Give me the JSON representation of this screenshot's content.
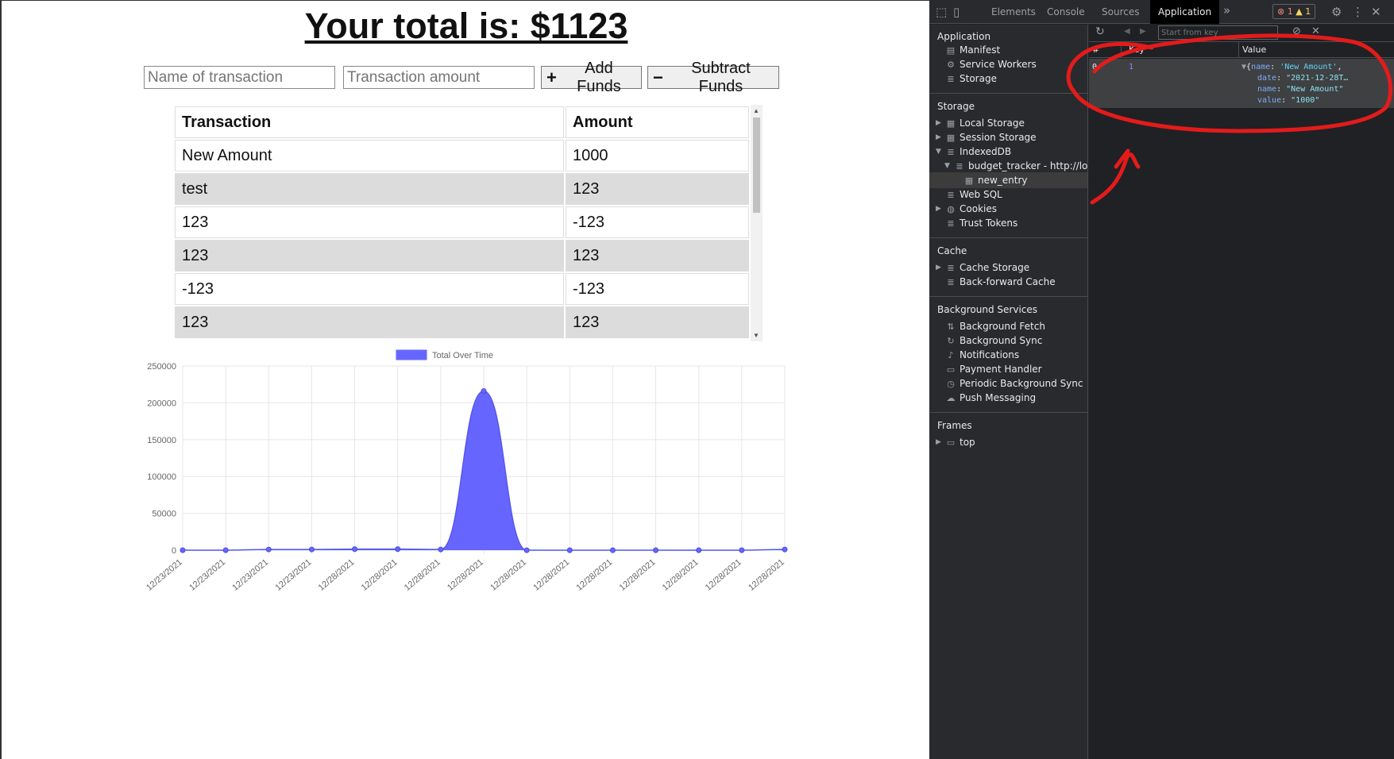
{
  "page": {
    "title": "Your total is: $1123",
    "name_placeholder": "Name of transaction",
    "amount_placeholder": "Transaction amount",
    "add_label": "Add Funds",
    "subtract_label": "Subtract Funds",
    "table": {
      "headers": [
        "Transaction",
        "Amount"
      ],
      "rows": [
        [
          "New Amount",
          "1000"
        ],
        [
          "test",
          "123"
        ],
        [
          "123",
          "-123"
        ],
        [
          "123",
          "123"
        ],
        [
          "-123",
          "-123"
        ],
        [
          "123",
          "123"
        ]
      ]
    }
  },
  "chart_data": {
    "type": "area",
    "legend": "Total Over Time",
    "legend_position": "top",
    "color": "#6666ff",
    "grid": true,
    "ylim": [
      0,
      250000
    ],
    "yticks": [
      0,
      50000,
      100000,
      150000,
      200000,
      250000
    ],
    "x": [
      "12/23/2021",
      "12/23/2021",
      "12/23/2021",
      "12/23/2021",
      "12/28/2021",
      "12/28/2021",
      "12/28/2021",
      "12/28/2021",
      "12/28/2021",
      "12/28/2021",
      "12/28/2021",
      "12/28/2021",
      "12/28/2021",
      "12/28/2021",
      "12/28/2021"
    ],
    "values": [
      0,
      0,
      1000,
      1000,
      1500,
      1500,
      1000,
      216000,
      0,
      0,
      0,
      0,
      0,
      0,
      1000
    ]
  },
  "devtools": {
    "tabs": [
      "Elements",
      "Console",
      "Sources",
      "Application"
    ],
    "active_tab": "Application",
    "errors": "1",
    "warnings": "1",
    "filter_placeholder": "Start from key",
    "sections": {
      "application": {
        "title": "Application",
        "items": [
          "Manifest",
          "Service Workers",
          "Storage"
        ]
      },
      "storage": {
        "title": "Storage",
        "items": [
          "Local Storage",
          "Session Storage",
          "IndexedDB",
          "budget_tracker - http://loca",
          "new_entry",
          "Web SQL",
          "Cookies",
          "Trust Tokens"
        ]
      },
      "cache": {
        "title": "Cache",
        "items": [
          "Cache Storage",
          "Back-forward Cache"
        ]
      },
      "background": {
        "title": "Background Services",
        "items": [
          "Background Fetch",
          "Background Sync",
          "Notifications",
          "Payment Handler",
          "Periodic Background Sync",
          "Push Messaging"
        ]
      },
      "frames": {
        "title": "Frames",
        "items": [
          "top"
        ]
      }
    },
    "grid": {
      "headers": [
        "#",
        "Key",
        "Value"
      ],
      "row": {
        "index": "0",
        "key": "1",
        "value_line1_key": "name",
        "value_line1_val": "'New Amount'",
        "date_key": "date",
        "date_val": "\"2021-12-28T…",
        "name_key": "name",
        "name_val": "\"New Amount\"",
        "value_key": "value",
        "value_val": "\"1000\""
      }
    },
    "icons": [
      "inspect-icon",
      "device-icon",
      "more-tabs-icon",
      "settings-icon",
      "kebab-icon",
      "close-icon",
      "refresh-icon",
      "back-icon",
      "forward-icon",
      "clear-icon",
      "delete-icon"
    ]
  }
}
